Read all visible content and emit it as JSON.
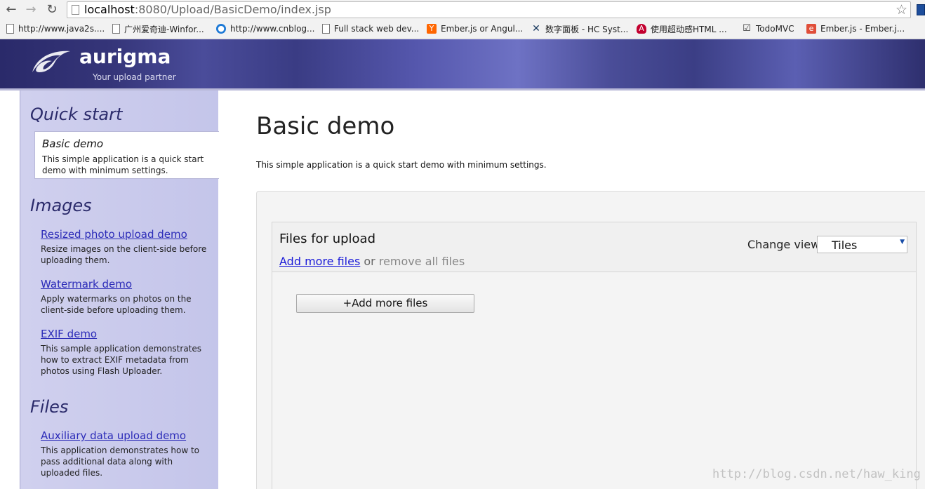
{
  "browser": {
    "url_host": "localhost",
    "url_rest": ":8080/Upload/BasicDemo/index.jsp",
    "bookmarks": [
      {
        "label": "http://www.java2s....",
        "icon": "page-icon"
      },
      {
        "label": "广州爱奇迪-Winfor...",
        "icon": "page-icon"
      },
      {
        "label": "http://www.cnblog...",
        "icon": "cnblogs-icon"
      },
      {
        "label": "Full stack web dev...",
        "icon": "page-icon"
      },
      {
        "label": "Ember.js or Angul...",
        "icon": "ycombinator-icon"
      },
      {
        "label": "数字面板 - HC Syst...",
        "icon": "x-logo-icon"
      },
      {
        "label": "使用超动感HTML ...",
        "icon": "angular-icon"
      },
      {
        "label": "TodoMVC",
        "icon": "checkbox-icon"
      },
      {
        "label": "Ember.js - Ember.j...",
        "icon": "ember-icon"
      }
    ]
  },
  "banner": {
    "logo_text": "aurigma",
    "tagline": "Your upload partner"
  },
  "sidebar": {
    "sections": [
      {
        "heading": "Quick start"
      },
      {
        "heading": "Images"
      },
      {
        "heading": "Files"
      }
    ],
    "active_item": {
      "title": "Basic demo",
      "desc": "This simple application is a quick start demo with minimum settings."
    },
    "links": [
      {
        "label": "Resized photo upload demo",
        "desc": "Resize images on the client-side before uploading them."
      },
      {
        "label": "Watermark demo",
        "desc": "Apply watermarks on photos on the client-side before uploading them."
      },
      {
        "label": "EXIF demo",
        "desc": "This sample application demonstrates how to extract EXIF metadata from photos using Flash Uploader."
      },
      {
        "label": "Auxiliary data upload demo",
        "desc": "This application demonstrates how to pass additional data along with uploaded files."
      }
    ]
  },
  "main": {
    "title": "Basic demo",
    "desc": "This simple application is a quick start demo with minimum settings."
  },
  "uploader": {
    "title": "Files for upload",
    "add_more_link": "Add more files",
    "or_text": " or ",
    "remove_all": "remove all files",
    "change_view_label": "Change view:",
    "change_view_value": "Tiles",
    "add_button": "+Add more files"
  },
  "watermark": "http://blog.csdn.net/haw_king",
  "colors": {
    "banner": "#3a3c84",
    "sidebar": "#c8c8ea",
    "link": "#2c2cb8"
  }
}
